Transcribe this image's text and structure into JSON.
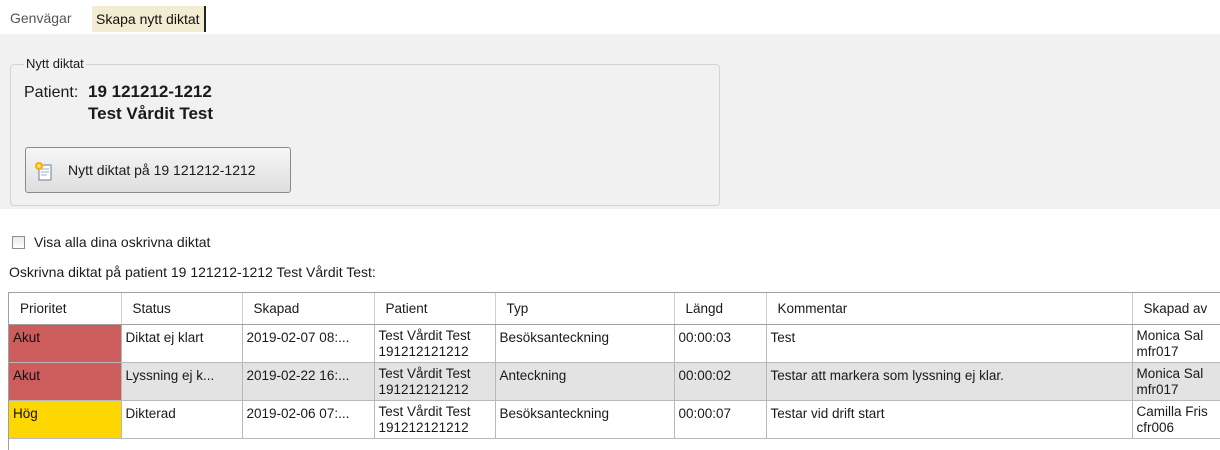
{
  "tabs": {
    "shortcuts": "Genvägar",
    "create": "Skapa nytt diktat"
  },
  "group": {
    "legend": "Nytt diktat",
    "patient_label": "Patient:",
    "patient_id": "19 121212-1212",
    "patient_name": "Test Vårdit Test",
    "new_button": "Nytt diktat på 19 121212-1212"
  },
  "show_all_checkbox": {
    "label": "Visa alla dina oskrivna diktat",
    "checked": false
  },
  "list_caption": "Oskrivna diktat på patient 19 121212-1212 Test Vårdit Test:",
  "colors": {
    "akut": "#cd5c5c",
    "hog": "#ffd700",
    "selected_row": "#e3e3e3"
  },
  "table": {
    "headers": [
      "Prioritet",
      "Status",
      "Skapad",
      "Patient",
      "Typ",
      "Längd",
      "Kommentar",
      "Skapad av"
    ],
    "rows": [
      {
        "priority": "Akut",
        "status": "Diktat ej klart",
        "created": "2019-02-07 08:...",
        "patient_name": "Test Vårdit Test",
        "patient_id": "191212121212",
        "type": "Besöksanteckning",
        "length": "00:00:03",
        "comment": "Test",
        "creator_name": "Monica Sal",
        "creator_id": "mfr017"
      },
      {
        "priority": "Akut",
        "status": "Lyssning ej k...",
        "created": "2019-02-22 16:...",
        "patient_name": "Test Vårdit Test",
        "patient_id": "191212121212",
        "type": "Anteckning",
        "length": "00:00:02",
        "comment": "Testar att markera som lyssning ej klar.",
        "creator_name": "Monica Sal",
        "creator_id": "mfr017"
      },
      {
        "priority": "Hög",
        "status": "Dikterad",
        "created": "2019-02-06 07:...",
        "patient_name": "Test Vårdit Test",
        "patient_id": "191212121212",
        "type": "Besöksanteckning",
        "length": "00:00:07",
        "comment": "Testar vid drift start",
        "creator_name": "Camilla Fris",
        "creator_id": "cfr006"
      }
    ]
  }
}
